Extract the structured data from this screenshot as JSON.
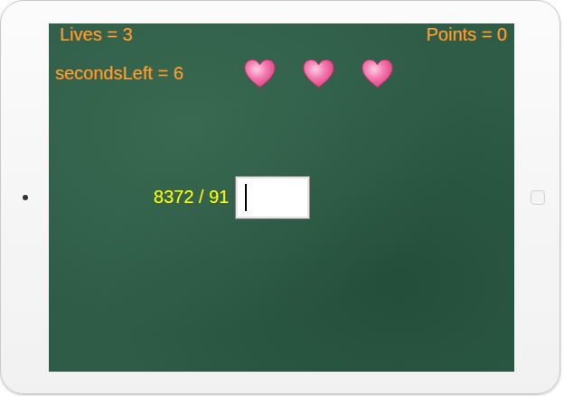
{
  "hud": {
    "lives": "Lives = 3",
    "points": "Points = 0",
    "timer": "secondsLeft = 6"
  },
  "hearts": [
    {
      "filled": true
    },
    {
      "filled": true
    },
    {
      "filled": true
    }
  ],
  "question": {
    "text": "8372 / 91"
  },
  "answer": {
    "value": "",
    "focused": true
  }
}
